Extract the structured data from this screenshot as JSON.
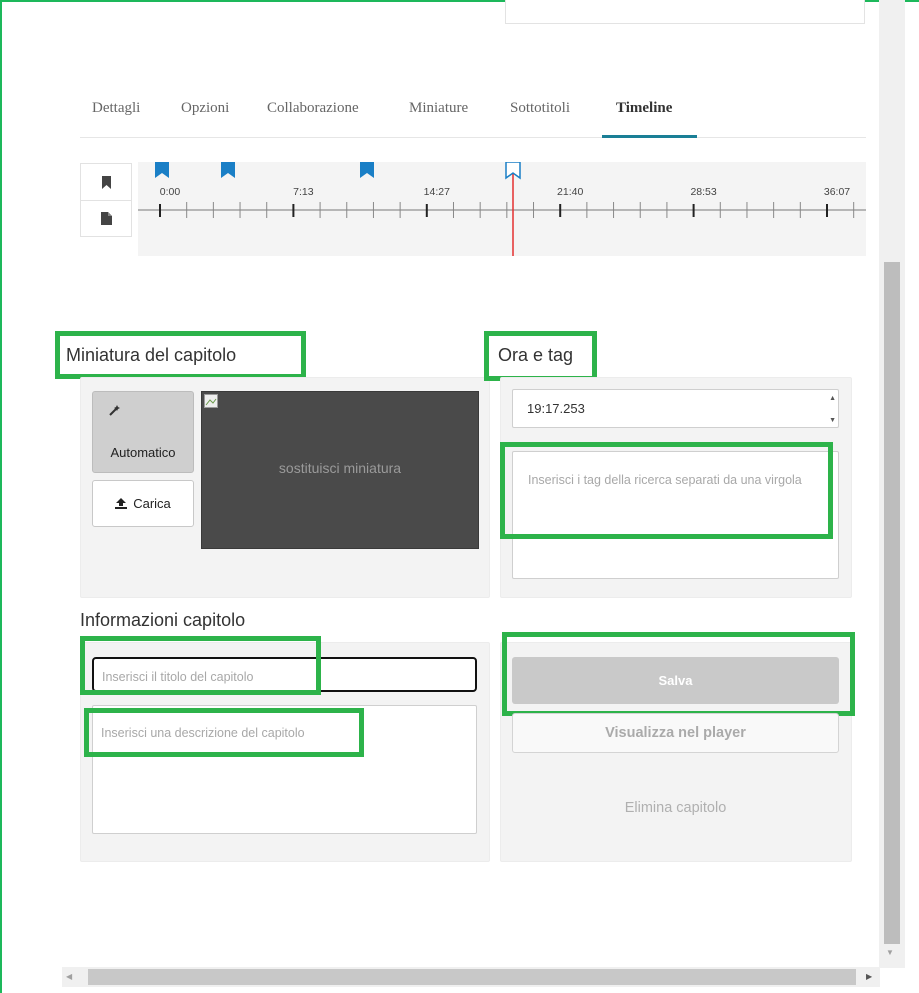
{
  "tabs": [
    {
      "label": "Dettagli"
    },
    {
      "label": "Opzioni"
    },
    {
      "label": "Collaborazione"
    },
    {
      "label": "Miniature"
    },
    {
      "label": "Sottotitoli"
    },
    {
      "label": "Timeline",
      "active": true
    }
  ],
  "timeline": {
    "tick_labels": [
      "0:00",
      "7:13",
      "14:27",
      "21:40",
      "28:53",
      "36:07"
    ],
    "marker_color": "#1a7fc6",
    "playhead_color": "#e53030",
    "side_icons": [
      "bookmark-icon",
      "file-icon"
    ]
  },
  "chapter_thumbnail": {
    "heading": "Miniatura del capitolo",
    "auto_label": "Automatico",
    "upload_label": "Carica",
    "thumbnail_text": "sostituisci miniatura"
  },
  "time_tags": {
    "heading": "Ora e tag",
    "time_value": "19:17.253",
    "tags_placeholder": "Inserisci i tag della ricerca separati da una virgola"
  },
  "chapter_info": {
    "heading": "Informazioni capitolo",
    "title_placeholder": "Inserisci il titolo del capitolo",
    "description_placeholder": "Inserisci una descrizione del capitolo"
  },
  "actions": {
    "save_label": "Salva",
    "view_label": "Visualizza nel player",
    "delete_label": "Elimina capitolo"
  },
  "colors": {
    "highlight": "#2db34a",
    "tab_underline": "#1a7f96"
  }
}
